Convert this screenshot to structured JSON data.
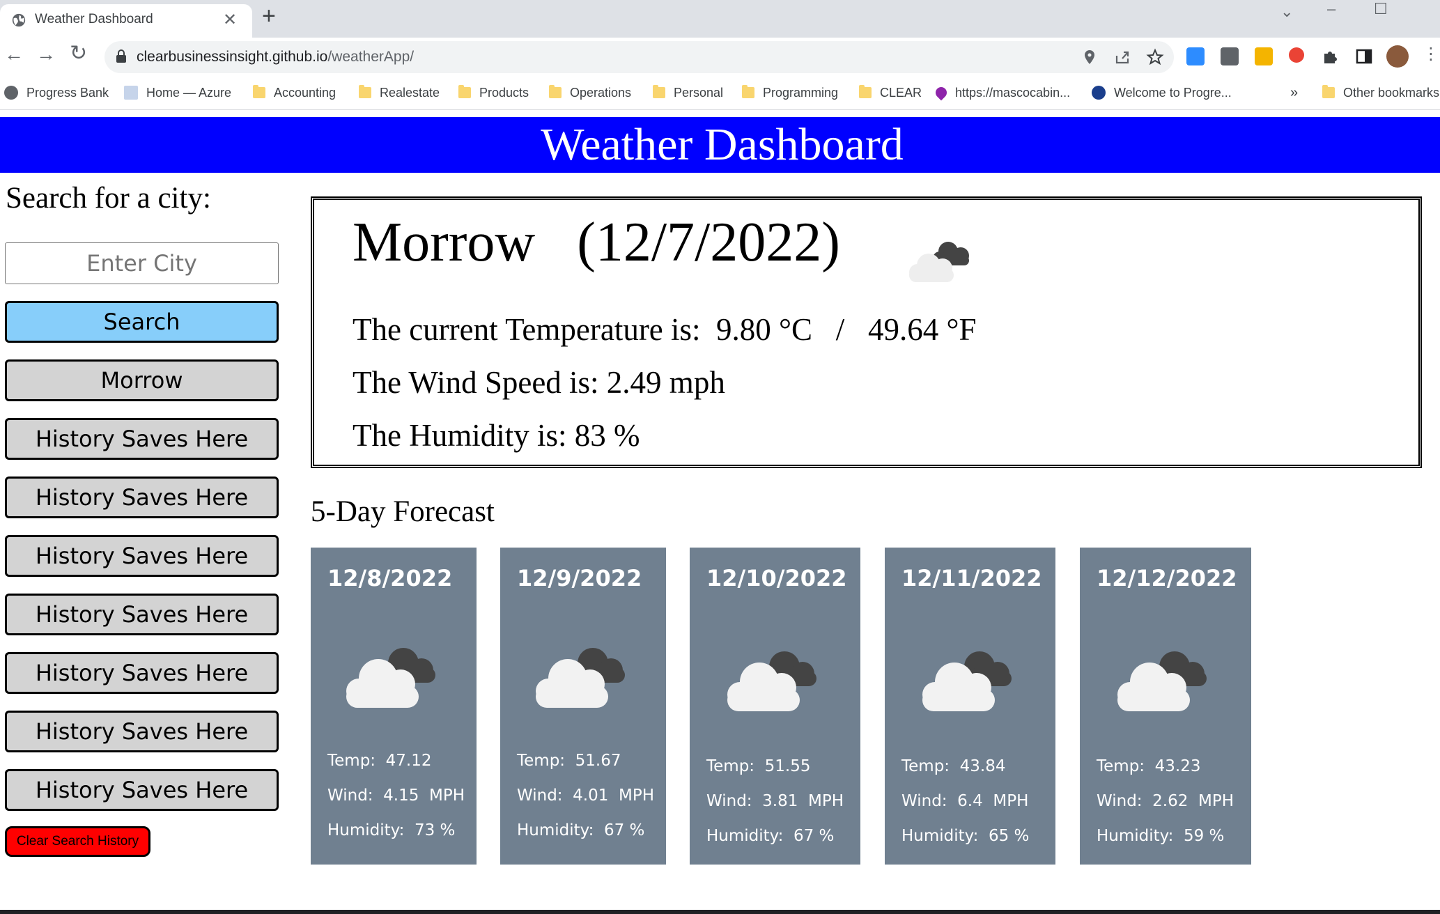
{
  "browser": {
    "tab_title": "Weather Dashboard",
    "new_tab": "+",
    "close_tab": "✕",
    "url_host": "clearbusinessinsight.github.io",
    "url_path": "/weatherApp/",
    "bookmarks": [
      "Progress Bank",
      "Home — Azure",
      "Accounting",
      "Realestate",
      "Products",
      "Operations",
      "Personal",
      "Programming",
      "CLEAR",
      "https://mascocabin...",
      "Welcome to Progre..."
    ],
    "bookmarks_overflow": "»",
    "other_bookmarks": "Other bookmarks"
  },
  "header": {
    "title": "Weather Dashboard"
  },
  "sidebar": {
    "search_label": "Search for a city:",
    "input_placeholder": "Enter City",
    "search_button": "Search",
    "history": [
      "Morrow",
      "History Saves Here",
      "History Saves Here",
      "History Saves Here",
      "History Saves Here",
      "History Saves Here",
      "History Saves Here",
      "History Saves Here"
    ],
    "clear_button": "Clear Search History"
  },
  "current": {
    "city_date": "Morrow   (12/7/2022)",
    "temperature_line": "The current Temperature is:  9.80 °C   /   49.64 °F",
    "wind_line": "The Wind Speed is: 2.49 mph",
    "humidity_line": "The Humidity is: 83 %",
    "icon": "cloud-icon"
  },
  "forecast": {
    "title": "5-Day Forecast",
    "days": [
      {
        "date": "12/8/2022",
        "temp": "Temp:  47.12",
        "wind": "Wind:  4.15  MPH",
        "humidity": "Humidity:  73 %"
      },
      {
        "date": "12/9/2022",
        "temp": "Temp:  51.67",
        "wind": "Wind:  4.01  MPH",
        "humidity": "Humidity:  67 %"
      },
      {
        "date": "12/10/2022",
        "temp": "Temp:  51.55",
        "wind": "Wind:  3.81  MPH",
        "humidity": "Humidity:  67 %"
      },
      {
        "date": "12/11/2022",
        "temp": "Temp:  43.84",
        "wind": "Wind:  6.4  MPH",
        "humidity": "Humidity:  65 %"
      },
      {
        "date": "12/12/2022",
        "temp": "Temp:  43.23",
        "wind": "Wind:  2.62  MPH",
        "humidity": "Humidity:  59 %"
      }
    ]
  },
  "colors": {
    "header": "#0000ff",
    "search_button": "#87cefa",
    "history_button": "#d3d3d3",
    "clear_button": "#ff0000",
    "forecast_card": "#708090"
  }
}
